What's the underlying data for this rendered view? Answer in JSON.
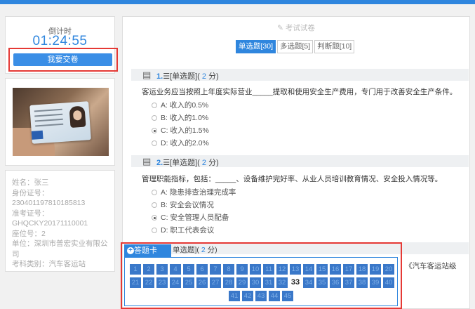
{
  "timer": {
    "label": "倒计时",
    "value": "01:24:55"
  },
  "submit_label": "我要交卷",
  "candidate": {
    "name": "姓名：张三",
    "id_label": "身份证号：",
    "id_value": "230401197810185813",
    "ticket_label": "准考证号：",
    "ticket_value": "GHQCKY20171110001",
    "seat": "座位号：2",
    "unit": "单位：深圳市普宏实业有限公司",
    "category": "考科类别：汽车客运站"
  },
  "paper_title": "考试试卷",
  "tabs": [
    {
      "label": "单选题[30]",
      "active": true
    },
    {
      "label": "多选题[5]",
      "active": false
    },
    {
      "label": "判断题[10]",
      "active": false
    }
  ],
  "questions": [
    {
      "num": "1.",
      "type": "[单选题](",
      "score": "2",
      "score_unit": "分)",
      "stem": "客运业务应当按照上年度实际营业_____提取和使用安全生产费用，专门用于改善安全生产条件。",
      "options": [
        {
          "text": "A: 收入的0.5%",
          "checked": false
        },
        {
          "text": "B: 收入的1.0%",
          "checked": false
        },
        {
          "text": "C: 收入的1.5%",
          "checked": true
        },
        {
          "text": "D: 收入的2.0%",
          "checked": false
        }
      ]
    },
    {
      "num": "2.",
      "type": "[单选题](",
      "score": "2",
      "score_unit": "分)",
      "stem": "管理职能指标，包括：_____、设备维护完好率、从业人员培训教育情况、安全投入情况等。",
      "options": [
        {
          "text": "A: 隐患排查治理完成率",
          "checked": false
        },
        {
          "text": "B: 安全会议情况",
          "checked": false
        },
        {
          "text": "C: 安全管理人员配备",
          "checked": true
        },
        {
          "text": "D: 职工代表会议",
          "checked": false
        }
      ]
    }
  ],
  "q3_partial": {
    "type": "单选题](",
    "score": "2",
    "score_unit": "分)",
    "tail": "《汽车客运站级"
  },
  "answer_card": {
    "label": "答题卡",
    "cells": [
      "1",
      "2",
      "3",
      "4",
      "5",
      "6",
      "7",
      "8",
      "9",
      "10",
      "11",
      "12",
      "13",
      "14",
      "15",
      "16",
      "17",
      "18",
      "19",
      "20",
      "21",
      "22",
      "23",
      "24",
      "25",
      "26",
      "27",
      "28",
      "29",
      "30",
      "31",
      "32",
      "33",
      "34",
      "35",
      "36",
      "37",
      "38",
      "39",
      "40",
      "41",
      "42",
      "43",
      "44",
      "45"
    ],
    "done": [
      "33"
    ]
  }
}
